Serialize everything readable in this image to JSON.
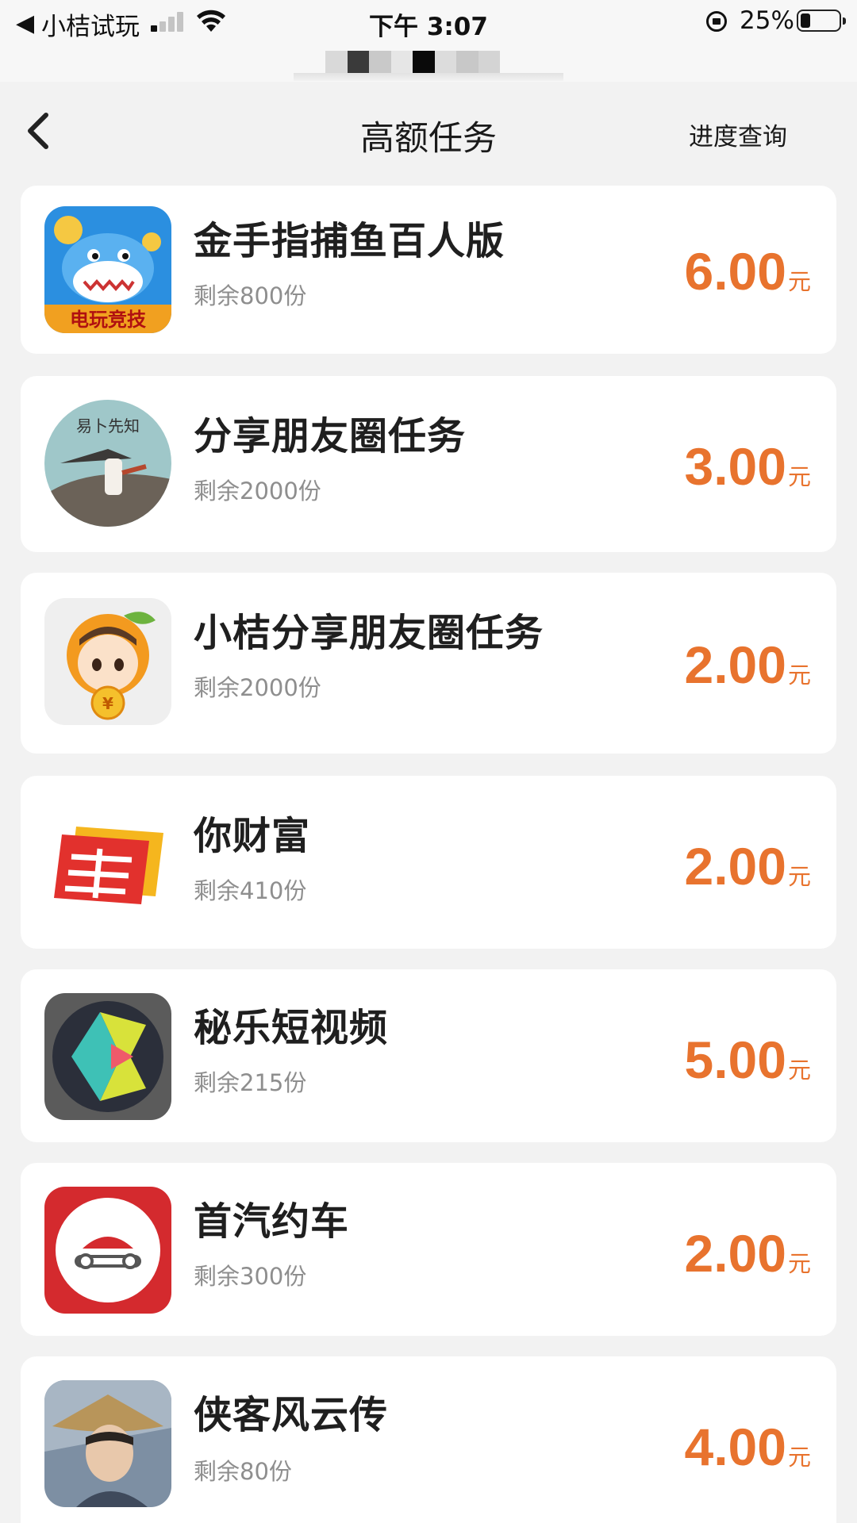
{
  "status_bar": {
    "back_glyph": "◀",
    "back_app": "小桔试玩",
    "time": "下午 3:07",
    "battery_percent": "25%",
    "battery_level": 0.25,
    "signal_bars_active": 1,
    "icons": [
      "signal-icon",
      "wifi-icon",
      "rotation-lock-icon",
      "battery-icon"
    ]
  },
  "nav": {
    "title": "高额任务",
    "action": "进度查询",
    "back_icon": "chevron-left-icon"
  },
  "colors": {
    "accent": "#e8732e",
    "background": "#f2f2f2",
    "card": "#ffffff",
    "secondary_text": "#8e8e8e"
  },
  "tasks": [
    {
      "name": "金手指捕鱼百人版",
      "remaining": "剩余800份",
      "amount": "6.00",
      "unit": "元",
      "icon": "shark-game-icon",
      "icon_text": "电玩竞技"
    },
    {
      "name": "分享朋友圈任务",
      "remaining": "剩余2000份",
      "amount": "3.00",
      "unit": "元",
      "icon": "fisherman-icon",
      "icon_text": "易卜先知"
    },
    {
      "name": "小桔分享朋友圈任务",
      "remaining": "剩余2000份",
      "amount": "2.00",
      "unit": "元",
      "icon": "orange-mascot-icon",
      "icon_text": "¥"
    },
    {
      "name": "你财富",
      "remaining": "剩余410份",
      "amount": "2.00",
      "unit": "元",
      "icon": "postal-logo-icon"
    },
    {
      "name": "秘乐短视频",
      "remaining": "剩余215份",
      "amount": "5.00",
      "unit": "元",
      "icon": "video-play-icon"
    },
    {
      "name": "首汽约车",
      "remaining": "剩余300份",
      "amount": "2.00",
      "unit": "元",
      "icon": "car-logo-icon"
    },
    {
      "name": "侠客风云传",
      "remaining": "剩余80份",
      "amount": "4.00",
      "unit": "元",
      "icon": "swordsman-icon"
    }
  ]
}
